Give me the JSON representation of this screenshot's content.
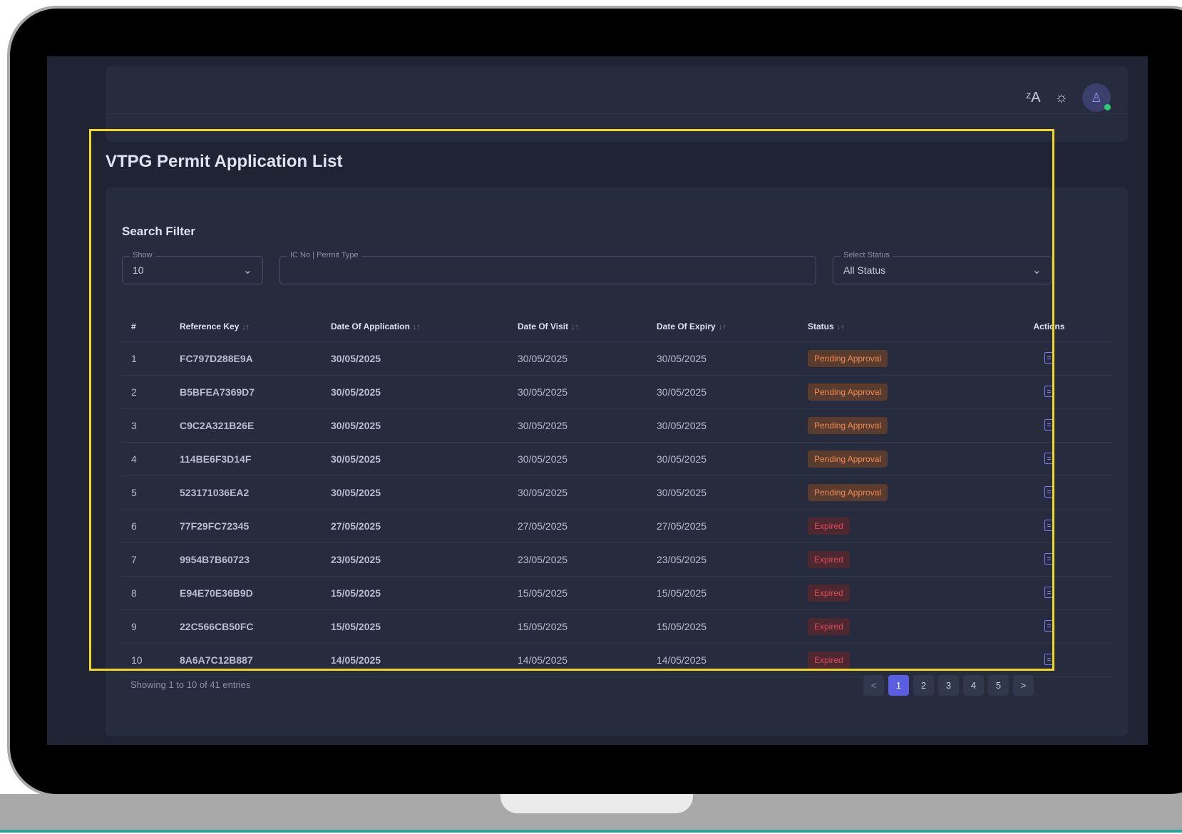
{
  "page": {
    "title": "VTPG Permit Application List"
  },
  "navbar": {
    "translate_icon": "translate-icon",
    "theme_icon": "sun-icon",
    "avatar_icon": "user-icon"
  },
  "filter": {
    "title": "Search Filter",
    "show": {
      "label": "Show",
      "value": "10"
    },
    "search": {
      "label": "IC No | Permit Type",
      "value": ""
    },
    "status": {
      "label": "Select Status",
      "value": "All Status"
    }
  },
  "table": {
    "columns": [
      "#",
      "Reference Key",
      "Date Of Application",
      "Date Of Visit",
      "Date Of Expiry",
      "Status",
      "Actions"
    ],
    "rows": [
      [
        "1",
        "FC797D288E9A",
        "30/05/2025",
        "30/05/2025",
        "30/05/2025",
        "Pending Approval"
      ],
      [
        "2",
        "B5BFEA7369D7",
        "30/05/2025",
        "30/05/2025",
        "30/05/2025",
        "Pending Approval"
      ],
      [
        "3",
        "C9C2A321B26E",
        "30/05/2025",
        "30/05/2025",
        "30/05/2025",
        "Pending Approval"
      ],
      [
        "4",
        "114BE6F3D14F",
        "30/05/2025",
        "30/05/2025",
        "30/05/2025",
        "Pending Approval"
      ],
      [
        "5",
        "523171036EA2",
        "30/05/2025",
        "30/05/2025",
        "30/05/2025",
        "Pending Approval"
      ],
      [
        "6",
        "77F29FC72345",
        "27/05/2025",
        "27/05/2025",
        "27/05/2025",
        "Expired"
      ],
      [
        "7",
        "9954B7B60723",
        "23/05/2025",
        "23/05/2025",
        "23/05/2025",
        "Expired"
      ],
      [
        "8",
        "E94E70E36B9D",
        "15/05/2025",
        "15/05/2025",
        "15/05/2025",
        "Expired"
      ],
      [
        "9",
        "22C566CB50FC",
        "15/05/2025",
        "15/05/2025",
        "15/05/2025",
        "Expired"
      ],
      [
        "10",
        "8A6A7C12B887",
        "14/05/2025",
        "14/05/2025",
        "14/05/2025",
        "Expired"
      ]
    ]
  },
  "footer": {
    "info": "Showing 1 to 10 of 41 entries",
    "pages": [
      "1",
      "2",
      "3",
      "4",
      "5"
    ],
    "prev": "<",
    "next": ">"
  },
  "colors": {
    "accent": "#5a5ee0",
    "pending": "#f08a55",
    "expired": "#e04a55",
    "highlight": "#f2d81f"
  }
}
